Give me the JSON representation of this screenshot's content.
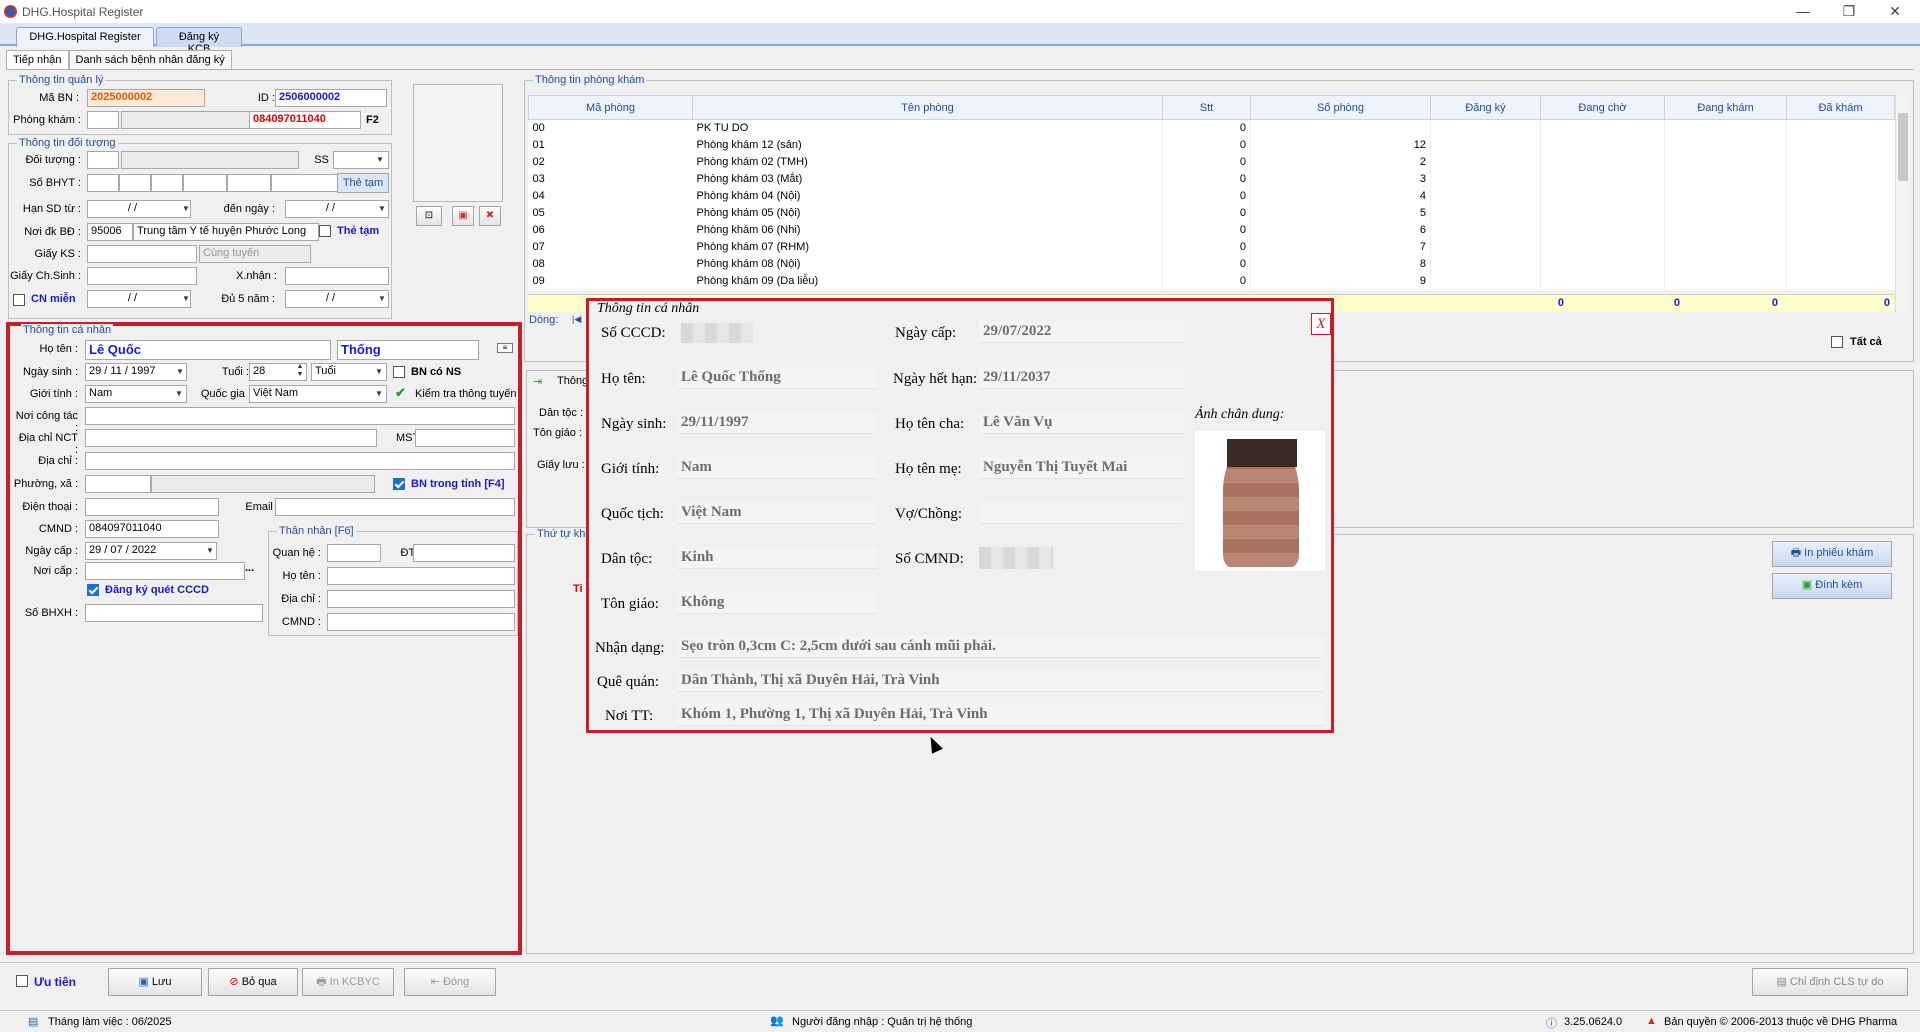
{
  "window": {
    "title": "DHG.Hospital Register",
    "min": "—",
    "max": "❐",
    "close": "✕"
  },
  "tabs": [
    "DHG.Hospital Register",
    "Đăng ký KCB"
  ],
  "subtabs": [
    "Tiếp nhận",
    "Danh sách bệnh nhân đăng ký"
  ],
  "quanly": {
    "group": "Thông tin quản lý",
    "ma_bn_label": "Mã BN :",
    "ma_bn": "2025000002",
    "id_label": "ID :",
    "id": "2506000002",
    "phong_kham_label": "Phòng khám :",
    "phong_kham_code": "084097011040",
    "f2": "F2"
  },
  "doituong": {
    "group": "Thông tin đối tượng",
    "doi_tuong_label": "Đối tượng :",
    "ss_label": "SS :",
    "so_bhyt_label": "Số BHYT :",
    "the_tam_btn": "Thẻ tạm",
    "han_sd_label": "Hạn SD từ :",
    "han_sd_tu": "/   /",
    "den_ngay_label": "đến ngày :",
    "den_ngay": "/   /",
    "noi_dk_label": "Nơi đk BĐ :",
    "noi_dk_code": "95006",
    "noi_dk_name": "Trung tâm Y tế huyện Phước Long",
    "the_tam_chk": "Thẻ tạm",
    "giay_ks_label": "Giấy KS :",
    "cung_tuyen": "Cùng tuyến",
    "giay_chsinh_label": "Giấy Ch.Sinh :",
    "xnhan_label": "X.nhận :",
    "cn_mien_label": "CN miễn",
    "cn_mien_date": "/   /",
    "du5nam_label": "Đủ 5 năm :",
    "du5nam_date": "/   /"
  },
  "canhan": {
    "group": "Thông tin cá nhân",
    "ho_ten_label": "Họ tên :",
    "ho": "Lê Quốc",
    "ten": "Thống",
    "ngay_sinh_label": "Ngày sinh :",
    "ngay_sinh": "29 / 11 / 1997",
    "tuoi_label": "Tuổi :",
    "tuoi": "28",
    "tuoi_unit": "Tuổi",
    "bn_co_ns": "BN có NS",
    "gioi_tinh_label": "Giới tính :",
    "gioi_tinh": "Nam",
    "quoc_gia_label": "Quốc gia :",
    "quoc_gia": "Việt Nam",
    "kiem_tra": "Kiểm tra thông tuyến",
    "noi_cong_tac_label": "Nơi công tác :",
    "dia_chi_nct_label": "Địa chỉ  NCT :",
    "mst_label": "MST:",
    "dia_chi_label": "Địa chỉ :",
    "phuong_xa_label": "Phường, xã :",
    "bn_trong_tinh": "BN trong tỉnh [F4]",
    "dien_thoai_label": "Điện thoại :",
    "email_label": "Email :",
    "cmnd_label": "CMND :",
    "cmnd": "084097011040",
    "ngay_cap_label": "Ngày cấp :",
    "ngay_cap": "29 / 07 / 2022",
    "noi_cap_label": "Nơi cấp :",
    "dk_quet": "Đăng ký quét CCCD",
    "so_bhxh_label": "Số BHXH :"
  },
  "thannhan": {
    "group": "Thân nhân [F6]",
    "quan_he": "Quan hệ :",
    "dt": "ĐT:",
    "ho_ten": "Họ tên :",
    "dia_chi": "Địa chỉ :",
    "cmnd": "CMND :"
  },
  "phongkham": {
    "group": "Thông tin phòng khám",
    "headers": [
      "Mã phòng",
      "Tên phòng",
      "Stt",
      "Số phòng",
      "Đăng ký",
      "Đang chờ",
      "Đang khám",
      "Đã khám"
    ],
    "rows": [
      [
        "00",
        "PK TU DO",
        "0",
        "",
        "",
        "",
        "",
        ""
      ],
      [
        "01",
        "Phòng khám 12 (sản)",
        "0",
        "12",
        "",
        "",
        "",
        ""
      ],
      [
        "02",
        "Phòng khám 02 (TMH)",
        "0",
        "2",
        "",
        "",
        "",
        ""
      ],
      [
        "03",
        "Phòng khám 03 (Mắt)",
        "0",
        "3",
        "",
        "",
        "",
        ""
      ],
      [
        "04",
        "Phòng khám 04 (Nội)",
        "0",
        "4",
        "",
        "",
        "",
        ""
      ],
      [
        "05",
        "Phòng khám 05 (Nội)",
        "0",
        "5",
        "",
        "",
        "",
        ""
      ],
      [
        "06",
        "Phòng khám 06 (Nhi)",
        "0",
        "6",
        "",
        "",
        "",
        ""
      ],
      [
        "07",
        "Phòng khám 07 (RHM)",
        "0",
        "7",
        "",
        "",
        "",
        ""
      ],
      [
        "08",
        "Phòng khám 08 (Nội)",
        "0",
        "8",
        "",
        "",
        "",
        ""
      ],
      [
        "09",
        "Phòng khám 09 (Da liễu)",
        "0",
        "9",
        "",
        "",
        "",
        ""
      ]
    ],
    "totals": [
      "0",
      "0",
      "0",
      "0"
    ],
    "dong_label": "Dòng:",
    "tat_ca": "Tất cả"
  },
  "mid": {
    "thong": "Thông",
    "dan_toc": "Dân tộc :",
    "ton_giao": "Tôn giáo :",
    "giay_luu": "Giấy lưu :",
    "thu_tu": "Thứ tự khá",
    "ti": "Ti"
  },
  "right_buttons": {
    "in_phieu": "In phiếu khám",
    "dinh_kem": "Đính kèm",
    "chi_dinh": "Chỉ định CLS tự do"
  },
  "popup": {
    "title": "Thông tin cá nhân",
    "close": "X",
    "so_cccd_label": "Số CCCD:",
    "ngay_cap_label": "Ngày cấp:",
    "ngay_cap": "29/07/2022",
    "ho_ten_label": "Họ tên:",
    "ho_ten": "Lê Quốc Thống",
    "ngay_het_han_label": "Ngày hết hạn:",
    "ngay_het_han": "29/11/2037",
    "ngay_sinh_label": "Ngày sinh:",
    "ngay_sinh": "29/11/1997",
    "ho_ten_cha_label": "Họ tên cha:",
    "ho_ten_cha": "Lê Văn Vụ",
    "anh_label": "Ảnh chân dung:",
    "gioi_tinh_label": "Giới tính:",
    "gioi_tinh": "Nam",
    "ho_ten_me_label": "Họ tên mẹ:",
    "ho_ten_me": "Nguyễn Thị Tuyết Mai",
    "quoc_tich_label": "Quốc tịch:",
    "quoc_tich": "Việt Nam",
    "vo_chong_label": "Vợ/Chồng:",
    "vo_chong": "",
    "dan_toc_label": "Dân tộc:",
    "dan_toc": "Kinh",
    "so_cmnd_label": "Số CMND:",
    "ton_giao_label": "Tôn giáo:",
    "ton_giao": "Không",
    "nhan_dang_label": "Nhận dạng:",
    "nhan_dang": "Sẹo tròn 0,3cm C: 2,5cm dưới sau cánh mũi phải.",
    "que_quan_label": "Quê quán:",
    "que_quan": "Dân Thành, Thị xã Duyên Hải, Trà Vinh",
    "noi_tt_label": "Nơi TT:",
    "noi_tt": "Khóm 1, Phường 1, Thị xã Duyên Hải, Trà Vinh"
  },
  "bottom": {
    "uu_tien": "Ưu tiên",
    "luu": "Lưu",
    "bo_qua": "Bỏ qua",
    "in_kcbyc": "In KCBYC",
    "dong": "Đóng"
  },
  "status": {
    "thang": "Tháng làm việc : 06/2025",
    "nguoi": "Người đăng nhập : Quản trị hệ thống",
    "version": "3.25.0624.0",
    "ban_quyen": "Bản quyền © 2006-2013 thuộc về DHG Pharma"
  },
  "colors": {
    "accent": "#1f4e9a",
    "highlight_red": "#c91e2a",
    "total_row": "#ffffcc"
  }
}
